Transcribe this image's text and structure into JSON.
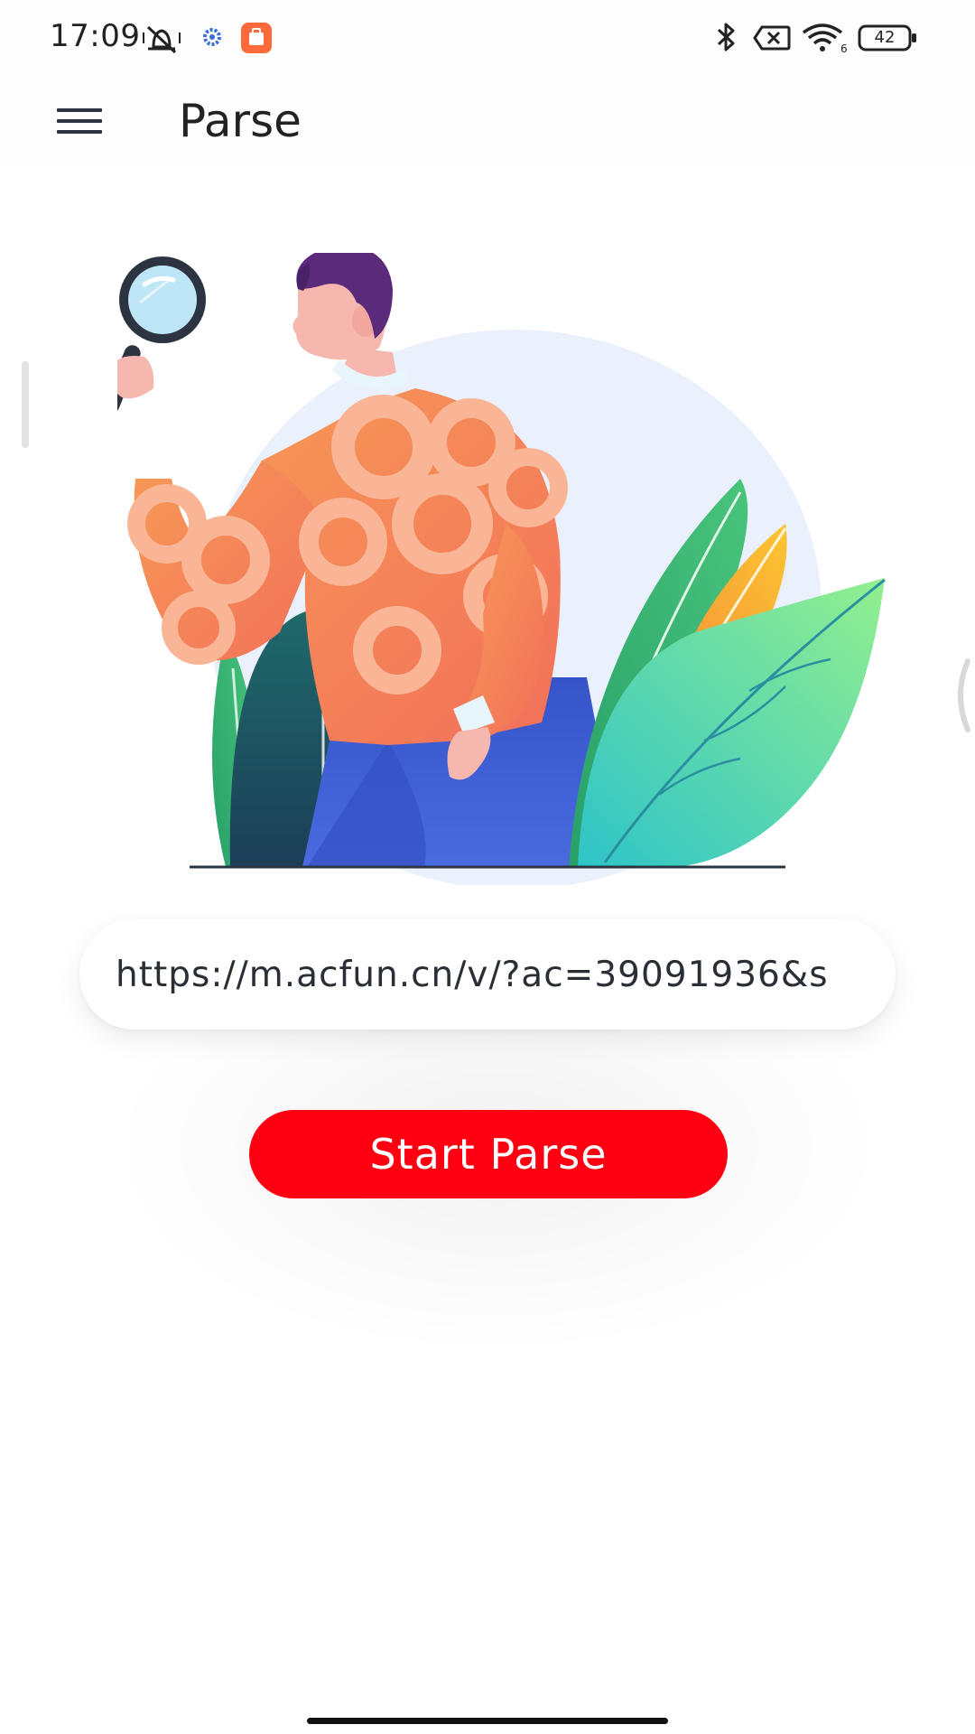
{
  "status_bar": {
    "time": "17:09",
    "battery": "42",
    "icons": [
      "vibrate-mute-icon",
      "settings-gear-icon",
      "app-notification-icon",
      "bluetooth-icon",
      "no-sim-icon",
      "wifi-icon",
      "battery-icon"
    ]
  },
  "app_bar": {
    "title": "Parse",
    "menu_icon": "hamburger-menu-icon"
  },
  "illustration": {
    "icon": "person-with-magnifier-illustration"
  },
  "input": {
    "value": "https://m.acfun.cn/v/?ac=39091936&s"
  },
  "actions": {
    "start_label": "Start Parse"
  },
  "colors": {
    "accent": "#ff0012",
    "text": "#222222"
  }
}
